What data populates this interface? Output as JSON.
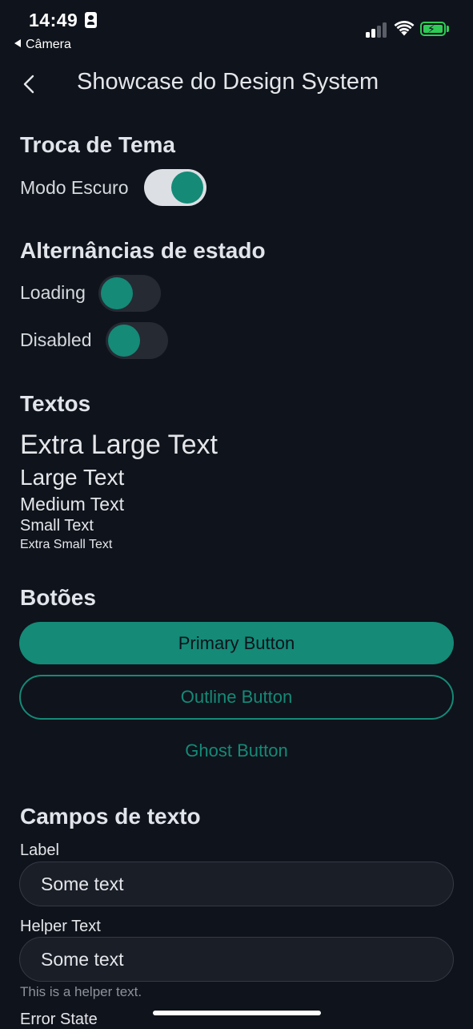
{
  "status_bar": {
    "time": "14:49",
    "back_app": "Câmera",
    "battery_color": "#2ecc55"
  },
  "nav": {
    "title": "Showcase do Design System",
    "back_icon": "chevron-left-icon"
  },
  "theme": {
    "heading": "Troca de Tema",
    "dark_mode_label": "Modo Escuro",
    "dark_mode_on": true
  },
  "states": {
    "heading": "Alternâncias de estado",
    "loading_label": "Loading",
    "loading_on": false,
    "disabled_label": "Disabled",
    "disabled_on": false
  },
  "texts": {
    "heading": "Textos",
    "xl": "Extra Large Text",
    "lg": "Large Text",
    "md": "Medium Text",
    "sm": "Small Text",
    "xs": "Extra Small Text"
  },
  "buttons": {
    "heading": "Botões",
    "primary": "Primary Button",
    "outline": "Outline Button",
    "ghost": "Ghost Button"
  },
  "fields": {
    "heading": "Campos de texto",
    "field1_label": "Label",
    "field1_value": "Some text",
    "field2_label": "Helper Text",
    "field2_value": "Some text",
    "field2_helper": "This is a helper text.",
    "field3_label": "Error State"
  },
  "colors": {
    "accent": "#148a77",
    "background": "#0f131b",
    "surface": "#1a1e27"
  }
}
